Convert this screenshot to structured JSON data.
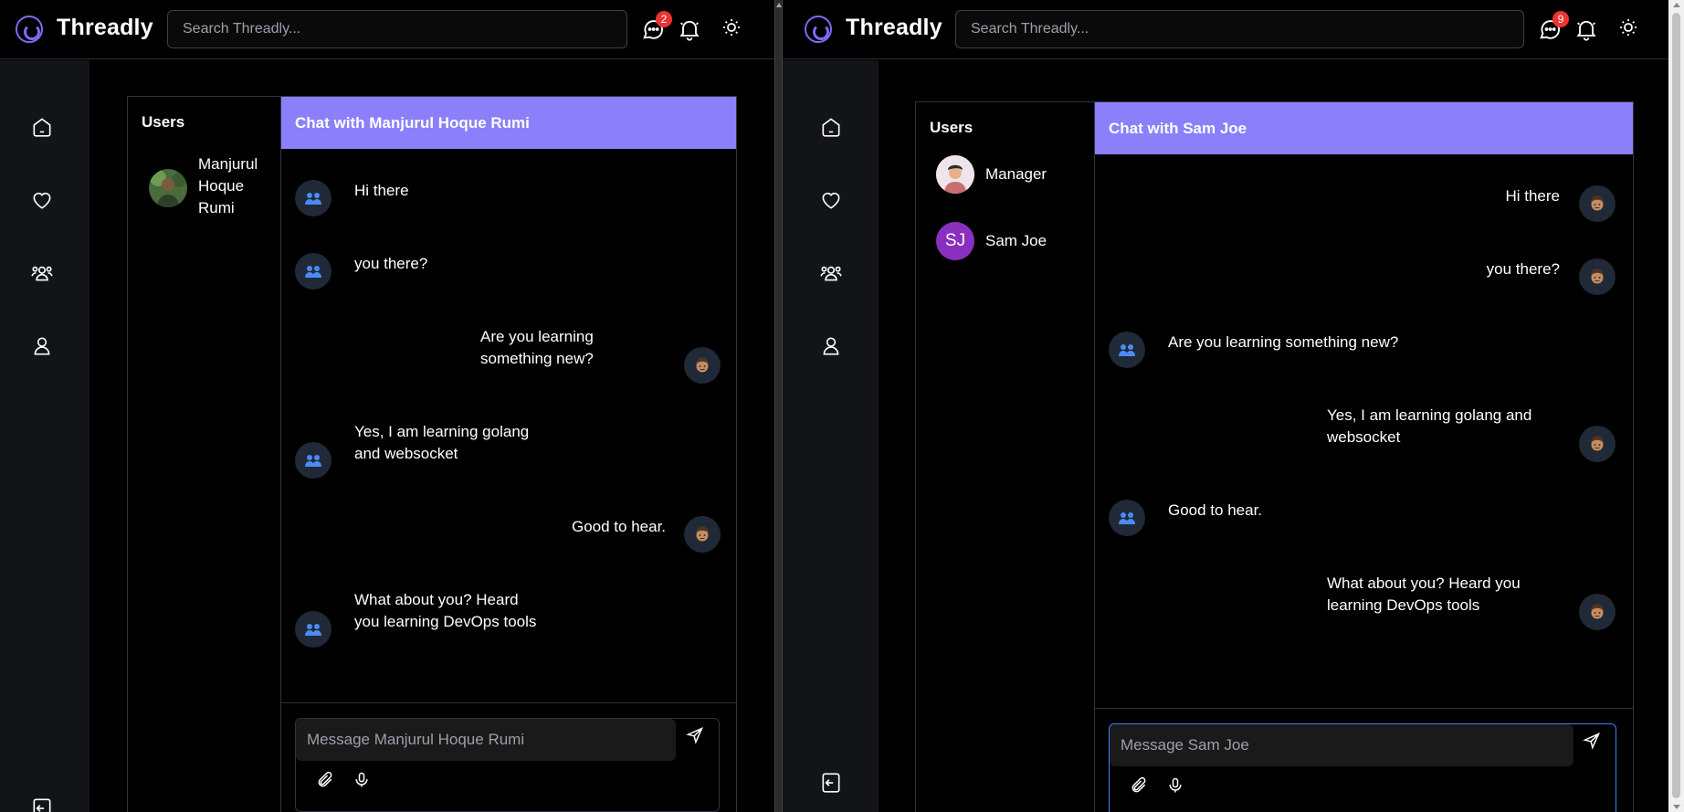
{
  "app": {
    "brand": "Threadly",
    "accent": "#8b80f9",
    "badge_color": "#e33"
  },
  "left": {
    "search_placeholder": "Search Threadly...",
    "messages_badge": "2",
    "users_title": "Users",
    "users": [
      {
        "name": "Manjurul Hoque Rumi",
        "lines": [
          "Manjurul",
          "Hoque",
          "Rumi"
        ]
      }
    ],
    "chat_title": "Chat with Manjurul Hoque Rumi",
    "messages": [
      {
        "side": "in",
        "lines": [
          "Hi there"
        ]
      },
      {
        "side": "in",
        "lines": [
          "you there?"
        ]
      },
      {
        "side": "out",
        "lines": [
          "Are you learning",
          "something new?"
        ]
      },
      {
        "side": "in",
        "lines": [
          "Yes, I am learning golang",
          "and websocket"
        ]
      },
      {
        "side": "out",
        "lines": [
          "Good to hear."
        ]
      },
      {
        "side": "in",
        "lines": [
          "What about you? Heard",
          "you learning DevOps tools"
        ]
      }
    ],
    "input_placeholder": "Message Manjurul Hoque Rumi"
  },
  "right": {
    "search_placeholder": "Search Threadly...",
    "messages_badge": "9",
    "users_title": "Users",
    "users": [
      {
        "name": "Manager"
      },
      {
        "name": "Sam Joe",
        "initials": "SJ"
      }
    ],
    "chat_title": "Chat with Sam Joe",
    "messages": [
      {
        "side": "out",
        "lines": [
          "Hi there"
        ]
      },
      {
        "side": "out",
        "lines": [
          "you there?"
        ]
      },
      {
        "side": "in",
        "lines": [
          "Are you learning something new?"
        ]
      },
      {
        "side": "out",
        "lines": [
          "Yes, I am learning golang and",
          "websocket"
        ]
      },
      {
        "side": "in",
        "lines": [
          "Good to hear."
        ]
      },
      {
        "side": "out",
        "lines": [
          "What about you? Heard you",
          "learning DevOps tools"
        ]
      }
    ],
    "input_placeholder": "Message Sam Joe"
  },
  "icons": {
    "nav": [
      "home-icon",
      "heart-icon",
      "users-group-icon",
      "user-icon",
      "logout-icon"
    ],
    "topbar": [
      "messages-icon",
      "bell-icon",
      "sun-icon"
    ],
    "composer": [
      "paperclip-icon",
      "microphone-icon",
      "send-icon"
    ]
  }
}
